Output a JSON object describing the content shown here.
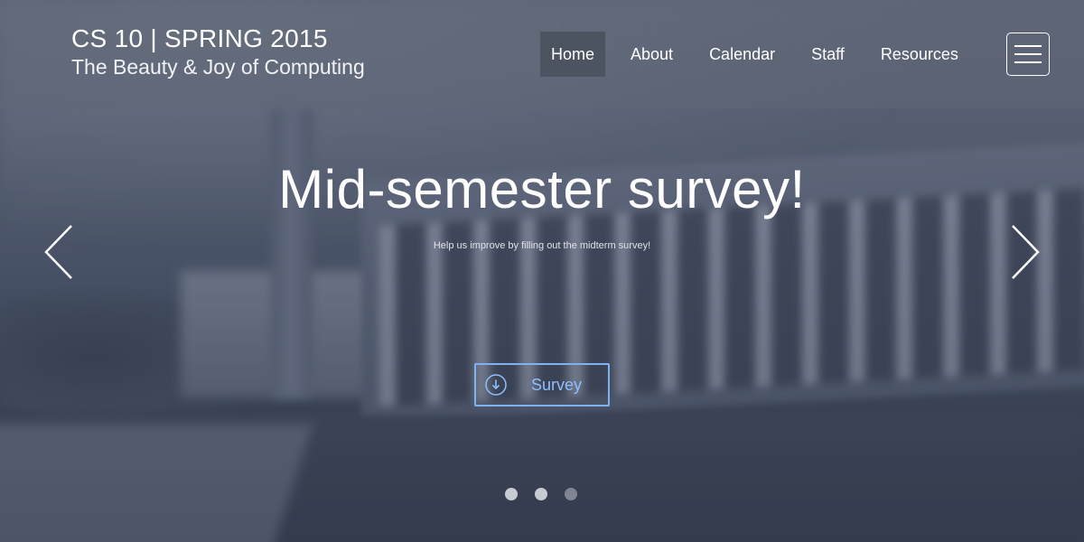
{
  "header": {
    "title": "CS 10 | SPRING 2015",
    "subtitle": "The Beauty & Joy of Computing"
  },
  "nav": {
    "items": [
      {
        "label": "Home",
        "active": true
      },
      {
        "label": "About",
        "active": false
      },
      {
        "label": "Calendar",
        "active": false
      },
      {
        "label": "Staff",
        "active": false
      },
      {
        "label": "Resources",
        "active": false
      }
    ],
    "menu_icon": "hamburger-menu-icon"
  },
  "slide": {
    "title": "Mid-semester survey!",
    "caption": "Help us improve by filling out the midterm survey!",
    "button_label": "Survey",
    "button_icon": "download-circle-icon"
  },
  "carousel": {
    "prev_icon": "chevron-left-icon",
    "next_icon": "chevron-right-icon",
    "slide_count": 3,
    "active_index": 0
  },
  "colors": {
    "accent": "#7fb2f2",
    "text": "#ffffff"
  }
}
